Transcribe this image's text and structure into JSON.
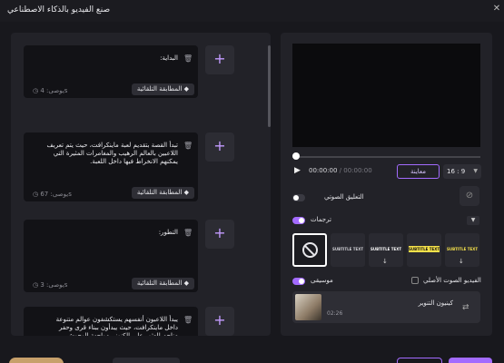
{
  "window": {
    "title": "صنع الفيديو بالذكاء الاصطناعي"
  },
  "scenes": [
    {
      "text": "البداية:",
      "auto_label": "المطابقة التلقائية",
      "duration": "يوصى: 4s"
    },
    {
      "text": "تبدأ القصة بتقديم لعبة ماينكرافت، حيث يتم تعريف اللاعبين بالعالم الرهيب والمغامرات المثيرة التي يمكنهم الانخراط فيها داخل اللعبة.",
      "auto_label": "المطابقة التلقائية",
      "duration": "يوصى: 67s"
    },
    {
      "text": "التطور:",
      "auto_label": "المطابقة التلقائية",
      "duration": "يوصى: 3s"
    },
    {
      "text": "يبدأ اللاعبون أنفسهم يستكشفون عوالم متنوعة داخل ماينكرافت، حيث يبدأون ببناء قرى وحفر مناجم للعثور على الكنوز ومواجهة الوحوش.",
      "auto_label": "",
      "duration": ""
    }
  ],
  "player": {
    "current_time": "00:00:00",
    "total_time": "00:00:00",
    "preview_label": "معاينة",
    "ratio": "16 : 9"
  },
  "voice": {
    "label": "التعليق الصوتي"
  },
  "subtitles": {
    "label": "ترجمات",
    "styles": [
      {
        "sample": "SUBTITLE TEXT",
        "color": "#cfcfd4"
      },
      {
        "sample": "SUBTITLE TEXT",
        "color": "#ffffff"
      },
      {
        "sample": "SUBTITLE TEXT",
        "color": "#f5e14a"
      },
      {
        "sample": "SUBTITLE TEXT",
        "color": "#f5e14a"
      }
    ]
  },
  "music": {
    "label": "موسيقى",
    "original_audio_label": "الفيديو الصوت الأصلي",
    "track_title": "كينيون التنوير",
    "track_time": "02:26"
  },
  "colors": {
    "accent": "#a36bff"
  }
}
